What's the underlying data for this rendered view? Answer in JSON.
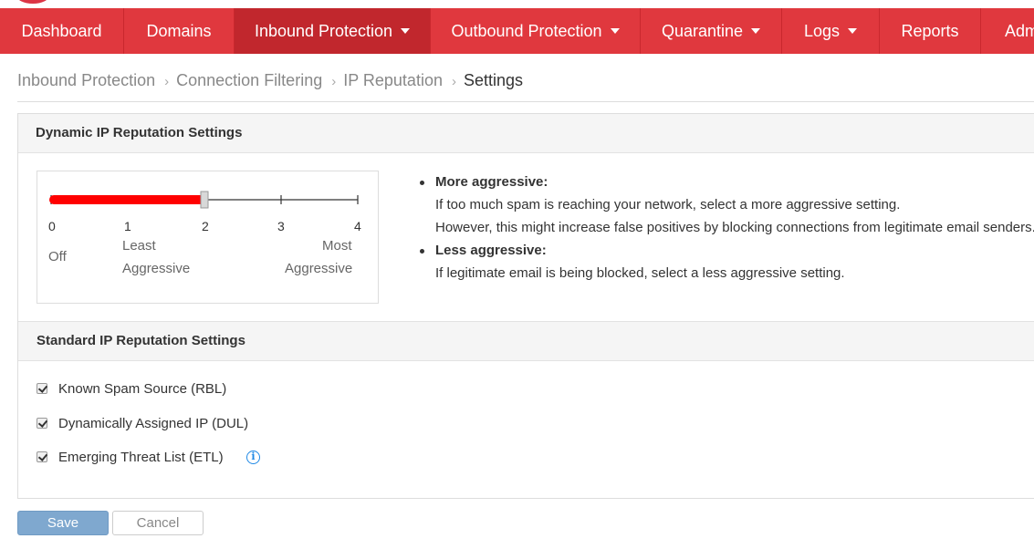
{
  "nav": {
    "items": [
      {
        "label": "Dashboard",
        "dropdown": false,
        "active": false
      },
      {
        "label": "Domains",
        "dropdown": false,
        "active": false
      },
      {
        "label": "Inbound Protection",
        "dropdown": true,
        "active": true
      },
      {
        "label": "Outbound Protection",
        "dropdown": true,
        "active": false
      },
      {
        "label": "Quarantine",
        "dropdown": true,
        "active": false
      },
      {
        "label": "Logs",
        "dropdown": true,
        "active": false
      },
      {
        "label": "Reports",
        "dropdown": false,
        "active": false
      },
      {
        "label": "Adm",
        "dropdown": false,
        "active": false
      }
    ]
  },
  "breadcrumb": [
    "Inbound Protection",
    "Connection Filtering",
    "IP Reputation",
    "Settings"
  ],
  "breadcrumb_separator": "›",
  "dynamic": {
    "title": "Dynamic IP Reputation Settings",
    "slider": {
      "ticks": [
        "0",
        "1",
        "2",
        "3",
        "4"
      ],
      "value": 2,
      "max": 4,
      "label_off": "Off",
      "label_least": [
        "Least",
        "Aggressive"
      ],
      "label_most": [
        "Most",
        "Aggressive"
      ]
    },
    "more": {
      "title": "More aggressive:",
      "lines": [
        "If too much spam is reaching your network, select a more aggressive setting.",
        "However, this might increase false positives by blocking connections from legitimate email senders."
      ]
    },
    "less": {
      "title": "Less aggressive:",
      "lines": [
        "If legitimate email is being blocked, select a less aggressive setting."
      ]
    }
  },
  "standard": {
    "title": "Standard IP Reputation Settings",
    "options": [
      {
        "label": "Known Spam Source (RBL)",
        "checked": true,
        "info": false
      },
      {
        "label": "Dynamically Assigned IP (DUL)",
        "checked": true,
        "info": false
      },
      {
        "label": "Emerging Threat List (ETL)",
        "checked": true,
        "info": true
      }
    ],
    "info_glyph": "i"
  },
  "buttons": {
    "save": "Save",
    "cancel": "Cancel"
  },
  "colors": {
    "nav_bg": "#e0383e",
    "nav_active": "#c1272d",
    "slider_fill": "#ff0000",
    "save_bg": "#7fa8cf",
    "info": "#1e88e5"
  }
}
